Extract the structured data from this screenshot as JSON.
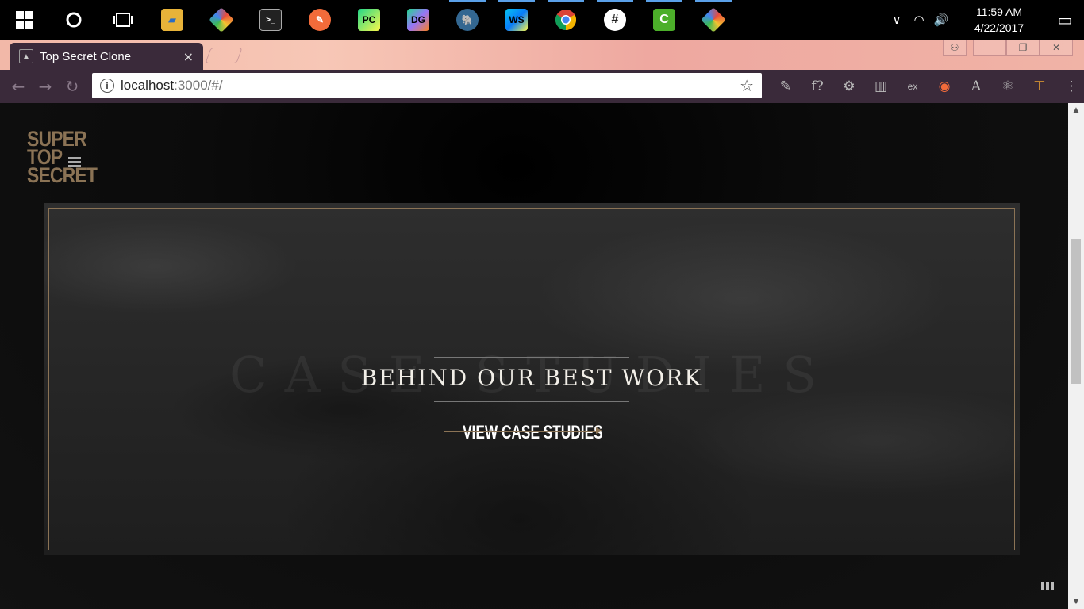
{
  "taskbar": {
    "apps": [
      {
        "name": "windows-start",
        "glyph": "⊞",
        "color": "#000000"
      },
      {
        "name": "cortana",
        "glyph": "○",
        "color": "#000000"
      },
      {
        "name": "task-view",
        "glyph": "❐",
        "color": "#000000"
      },
      {
        "name": "file-explorer",
        "glyph": "▰",
        "color": "#e8b339"
      },
      {
        "name": "gitkraken",
        "glyph": "◆",
        "color": "#7a7a7a"
      },
      {
        "name": "terminal",
        "glyph": ">_",
        "color": "#333333"
      },
      {
        "name": "postman",
        "glyph": "✎",
        "color": "#f26b3a"
      },
      {
        "name": "pycharm",
        "glyph": "PC",
        "color": "#22a35a"
      },
      {
        "name": "datagrip",
        "glyph": "DG",
        "color": "#8a3fd1"
      },
      {
        "name": "pgadmin",
        "glyph": "🐘",
        "color": "#336791"
      },
      {
        "name": "webstorm",
        "glyph": "WS",
        "color": "#1e88e5"
      },
      {
        "name": "chrome",
        "glyph": "◉",
        "color": "#db4437"
      },
      {
        "name": "slack",
        "glyph": "#",
        "color": "#222222"
      },
      {
        "name": "camtasia",
        "glyph": "C",
        "color": "#4caf2a"
      },
      {
        "name": "gitkraken-2",
        "glyph": "◆",
        "color": "#7a7a7a"
      }
    ],
    "tray": {
      "chevron": "∨",
      "wifi": "◠",
      "volume": "🔊",
      "time": "11:59 AM",
      "date": "4/22/2017",
      "notifications": "▭"
    }
  },
  "browser": {
    "tab_title": "Top Secret Clone",
    "tab_close": "×",
    "favicon_glyph": "▲",
    "nav": {
      "back": "←",
      "forward": "→",
      "reload": "↻"
    },
    "url_host": "localhost",
    "url_path": ":3000/#/",
    "info_glyph": "i",
    "star": "☆",
    "extensions": [
      "✎",
      "f?",
      "⚙",
      "▥",
      "ex",
      "◉",
      "A",
      "⚛",
      "⊤",
      "⋮"
    ],
    "window_buttons": {
      "profile": "⚇",
      "minimize": "—",
      "restore": "❐",
      "close": "✕"
    }
  },
  "site": {
    "logo_lines": [
      "SUPER",
      "TOP",
      "SECRET"
    ],
    "menu_icon": "hamburger",
    "hero": {
      "background_word": "CASE STUDIES",
      "headline": "BEHIND OUR BEST WORK",
      "cta": "VIEW CASE STUDIES"
    }
  },
  "colors": {
    "accent_gold": "#8b7355",
    "page_bg": "#121212",
    "browser_frame": "#3a2a3a"
  }
}
